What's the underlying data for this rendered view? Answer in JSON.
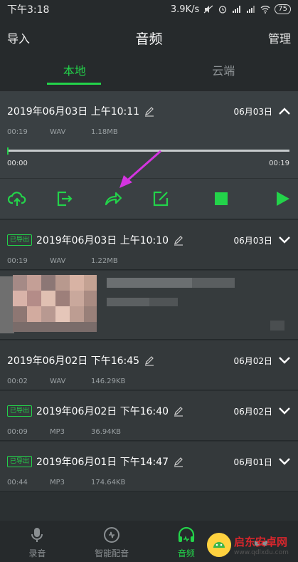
{
  "status_bar": {
    "time": "下午3:18",
    "network_speed": "3.9K/s",
    "battery": "75"
  },
  "header": {
    "left": "导入",
    "title": "音频",
    "right": "管理"
  },
  "tabs": [
    {
      "label": "本地",
      "active": true
    },
    {
      "label": "云端",
      "active": false
    }
  ],
  "recordings": [
    {
      "title": "2019年06月03日 上午10:11",
      "date": "06月03日",
      "duration": "00:19",
      "format": "WAV",
      "size": "1.18MB",
      "exported": false,
      "expanded": true
    },
    {
      "title": "2019年06月03日 上午10:10",
      "date": "06月03日",
      "duration": "00:19",
      "format": "WAV",
      "size": "1.22MB",
      "exported": true,
      "expanded": false
    },
    {
      "title": "2019年06月02日 下午16:45",
      "date": "06月02日",
      "duration": "00:02",
      "format": "WAV",
      "size": "146.29KB",
      "exported": false,
      "expanded": false
    },
    {
      "title": "2019年06月02日 下午16:40",
      "date": "06月02日",
      "duration": "00:09",
      "format": "MP3",
      "size": "36.94KB",
      "exported": true,
      "expanded": false
    },
    {
      "title": "2019年06月01日 下午14:47",
      "date": "06月01日",
      "duration": "00:44",
      "format": "MP3",
      "size": "174.64KB",
      "exported": true,
      "expanded": false
    }
  ],
  "exported_badge": "已导出",
  "player": {
    "current_time": "00:00",
    "total_time": "00:19",
    "progress": 0
  },
  "actions": [
    "cloud-upload-icon",
    "export-icon",
    "share-icon",
    "rename-icon",
    "stop-icon",
    "play-icon"
  ],
  "bottom_nav": [
    {
      "label": "录音",
      "icon": "mic-icon",
      "active": false
    },
    {
      "label": "智能配音",
      "icon": "dubbing-icon",
      "active": false
    },
    {
      "label": "音频",
      "icon": "headphones-icon",
      "active": true
    },
    {
      "label": "",
      "icon": "more-icon",
      "active": false
    }
  ],
  "watermark": {
    "main": "启东安卓网",
    "sub": "www.qdlxdu.com"
  },
  "colors": {
    "accent": "#23d34a",
    "background": "#2b3032",
    "card": "#34393b",
    "annotation_arrow": "#d434e0"
  }
}
